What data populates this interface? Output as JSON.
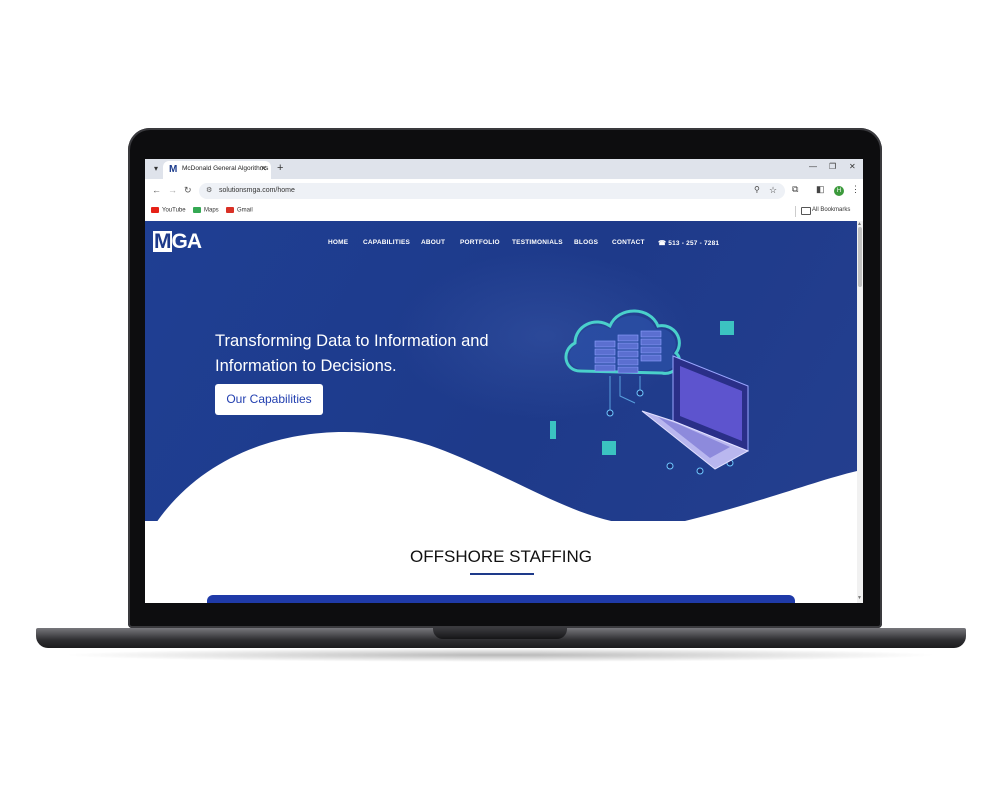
{
  "browser": {
    "tab_title": "McDonald General Algorithms",
    "tab_favicon": "M",
    "url": "solutionsmga.com/home",
    "profile_initial": "H",
    "bookmarks": [
      {
        "label": "YouTube",
        "color": "#e62117"
      },
      {
        "label": "Maps",
        "color": "#34a853"
      },
      {
        "label": "Gmail",
        "color": "#d93025"
      }
    ],
    "all_bookmarks": "All Bookmarks"
  },
  "site": {
    "logo": {
      "first": "M",
      "rest": "GA"
    },
    "nav": [
      "HOME",
      "CAPABILITIES",
      "ABOUT",
      "PORTFOLIO",
      "TESTIMONIALS",
      "BLOGS",
      "CONTACT"
    ],
    "phone": "☎ 513 - 257 - 7281",
    "headline_line1": "Transforming Data to Information and",
    "headline_line2": "Information to Decisions.",
    "cta_label": "Our Capabilities",
    "section_title": "OFFSHORE STAFFING"
  },
  "colors": {
    "hero_blue": "#1e3a8a",
    "accent": "#2340b0",
    "teal": "#3fd2c7"
  }
}
